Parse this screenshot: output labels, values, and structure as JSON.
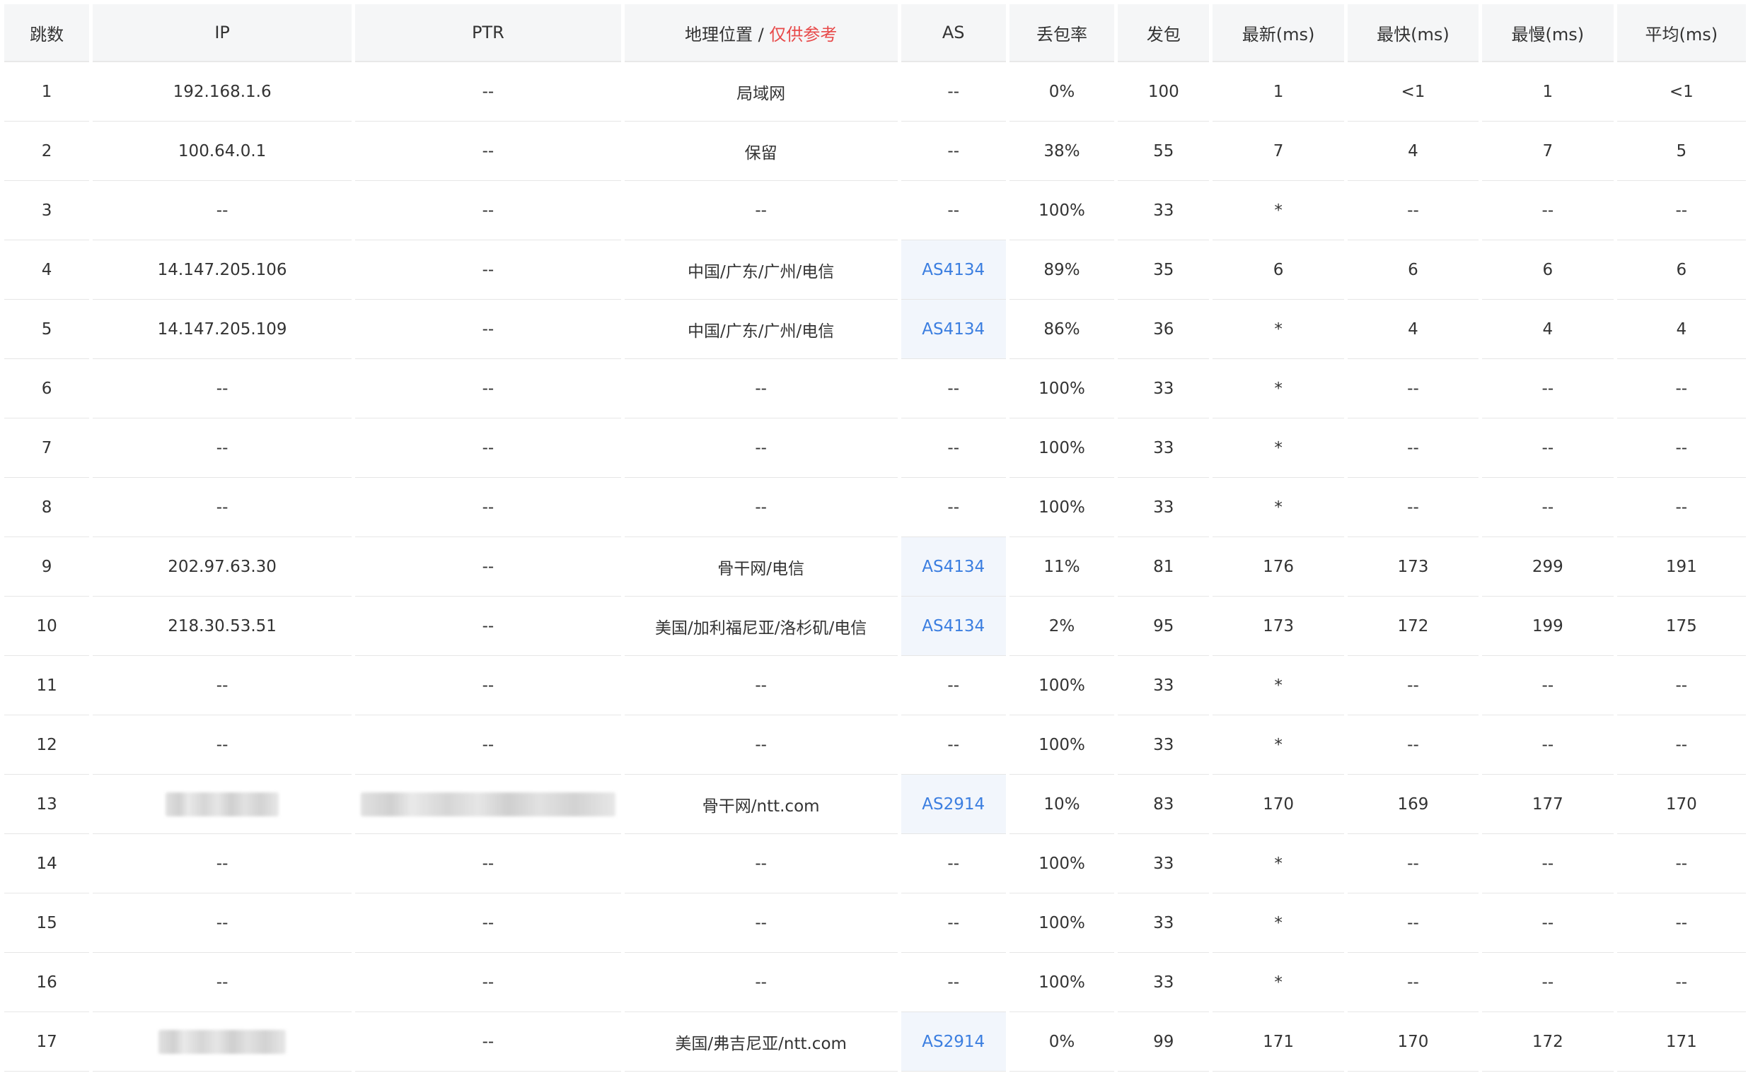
{
  "table": {
    "headers": {
      "hop": "跳数",
      "ip": "IP",
      "ptr": "PTR",
      "geo": "地理位置",
      "geo_sep": "/",
      "geo_note": "仅供参考",
      "as": "AS",
      "loss": "丢包率",
      "sent": "发包",
      "last": "最新(ms)",
      "best": "最快(ms)",
      "worst": "最慢(ms)",
      "avg": "平均(ms)"
    },
    "rows": [
      {
        "hop": "1",
        "ip": "192.168.1.6",
        "ptr": "--",
        "geo": "局域网",
        "as": "--",
        "loss": "0%",
        "sent": "100",
        "last": "1",
        "best": "<1",
        "worst": "1",
        "avg": "<1"
      },
      {
        "hop": "2",
        "ip": "100.64.0.1",
        "ptr": "--",
        "geo": "保留",
        "as": "--",
        "loss": "38%",
        "sent": "55",
        "last": "7",
        "best": "4",
        "worst": "7",
        "avg": "5"
      },
      {
        "hop": "3",
        "ip": "--",
        "ptr": "--",
        "geo": "--",
        "as": "--",
        "loss": "100%",
        "sent": "33",
        "last": "*",
        "best": "--",
        "worst": "--",
        "avg": "--"
      },
      {
        "hop": "4",
        "ip": "14.147.205.106",
        "ptr": "--",
        "geo": "中国/广东/广州/电信",
        "as": "AS4134",
        "loss": "89%",
        "sent": "35",
        "last": "6",
        "best": "6",
        "worst": "6",
        "avg": "6"
      },
      {
        "hop": "5",
        "ip": "14.147.205.109",
        "ptr": "--",
        "geo": "中国/广东/广州/电信",
        "as": "AS4134",
        "loss": "86%",
        "sent": "36",
        "last": "*",
        "best": "4",
        "worst": "4",
        "avg": "4"
      },
      {
        "hop": "6",
        "ip": "--",
        "ptr": "--",
        "geo": "--",
        "as": "--",
        "loss": "100%",
        "sent": "33",
        "last": "*",
        "best": "--",
        "worst": "--",
        "avg": "--"
      },
      {
        "hop": "7",
        "ip": "--",
        "ptr": "--",
        "geo": "--",
        "as": "--",
        "loss": "100%",
        "sent": "33",
        "last": "*",
        "best": "--",
        "worst": "--",
        "avg": "--"
      },
      {
        "hop": "8",
        "ip": "--",
        "ptr": "--",
        "geo": "--",
        "as": "--",
        "loss": "100%",
        "sent": "33",
        "last": "*",
        "best": "--",
        "worst": "--",
        "avg": "--"
      },
      {
        "hop": "9",
        "ip": "202.97.63.30",
        "ptr": "--",
        "geo": "骨干网/电信",
        "as": "AS4134",
        "loss": "11%",
        "sent": "81",
        "last": "176",
        "best": "173",
        "worst": "299",
        "avg": "191"
      },
      {
        "hop": "10",
        "ip": "218.30.53.51",
        "ptr": "--",
        "geo": "美国/加利福尼亚/洛杉矶/电信",
        "as": "AS4134",
        "loss": "2%",
        "sent": "95",
        "last": "173",
        "best": "172",
        "worst": "199",
        "avg": "175"
      },
      {
        "hop": "11",
        "ip": "--",
        "ptr": "--",
        "geo": "--",
        "as": "--",
        "loss": "100%",
        "sent": "33",
        "last": "*",
        "best": "--",
        "worst": "--",
        "avg": "--"
      },
      {
        "hop": "12",
        "ip": "--",
        "ptr": "--",
        "geo": "--",
        "as": "--",
        "loss": "100%",
        "sent": "33",
        "last": "*",
        "best": "--",
        "worst": "--",
        "avg": "--"
      },
      {
        "hop": "13",
        "ip": "",
        "ptr": "",
        "geo": "骨干网/ntt.com",
        "as": "AS2914",
        "loss": "10%",
        "sent": "83",
        "last": "170",
        "best": "169",
        "worst": "177",
        "avg": "170"
      },
      {
        "hop": "14",
        "ip": "--",
        "ptr": "--",
        "geo": "--",
        "as": "--",
        "loss": "100%",
        "sent": "33",
        "last": "*",
        "best": "--",
        "worst": "--",
        "avg": "--"
      },
      {
        "hop": "15",
        "ip": "--",
        "ptr": "--",
        "geo": "--",
        "as": "--",
        "loss": "100%",
        "sent": "33",
        "last": "*",
        "best": "--",
        "worst": "--",
        "avg": "--"
      },
      {
        "hop": "16",
        "ip": "--",
        "ptr": "--",
        "geo": "--",
        "as": "--",
        "loss": "100%",
        "sent": "33",
        "last": "*",
        "best": "--",
        "worst": "--",
        "avg": "--"
      },
      {
        "hop": "17",
        "ip": "",
        "ptr": "--",
        "geo": "美国/弗吉尼亚/ntt.com",
        "as": "AS2914",
        "loss": "0%",
        "sent": "99",
        "last": "171",
        "best": "170",
        "worst": "172",
        "avg": "171"
      }
    ]
  },
  "colors": {
    "header_bg": "#f5f6f7",
    "as_link": "#3b7ee0",
    "geo_note": "#e84a4a",
    "as_cell_bg": "#f2f6fc"
  }
}
